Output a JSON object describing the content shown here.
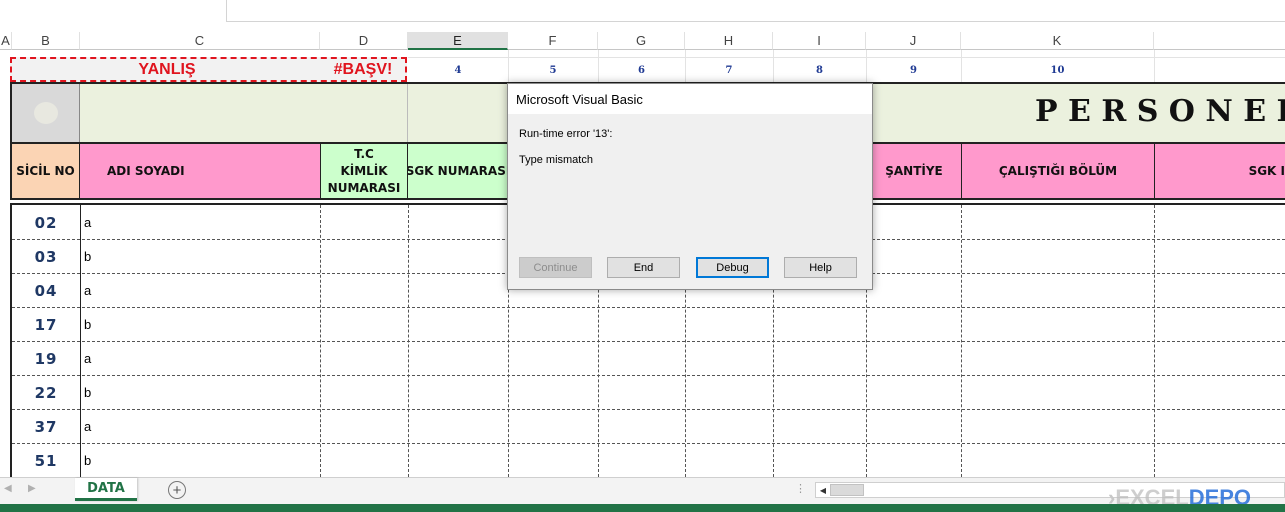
{
  "columns": [
    "A",
    "B",
    "C",
    "D",
    "E",
    "F",
    "G",
    "H",
    "I",
    "J",
    "K"
  ],
  "top_row": {
    "error_label": "YANLIŞ",
    "error_value": "#BAŞV!",
    "indices": [
      "4",
      "5",
      "6",
      "7",
      "8",
      "9",
      "10"
    ]
  },
  "title": "P E R S O N E L İ",
  "headers": {
    "sicil_no": "SİCİL NO",
    "adi_soyadi": "ADI SOYADI",
    "tc_line1": "T.C",
    "tc_line2": "KİMLİK",
    "tc_line3": "NUMARASI",
    "sgk_numarasi": "SGK NUMARASI",
    "santiye": "ŞANTİYE",
    "calistigi_bolum": "ÇALIŞTIĞI BÖLÜM",
    "sgk_partial": "SGK I"
  },
  "rows": [
    {
      "sicil": "02",
      "name": "a"
    },
    {
      "sicil": "03",
      "name": "b"
    },
    {
      "sicil": "04",
      "name": "a"
    },
    {
      "sicil": "17",
      "name": "b"
    },
    {
      "sicil": "19",
      "name": "a"
    },
    {
      "sicil": "22",
      "name": "b"
    },
    {
      "sicil": "37",
      "name": "a"
    },
    {
      "sicil": "51",
      "name": "b"
    }
  ],
  "dialog": {
    "title": "Microsoft Visual Basic",
    "error_line": "Run-time error '13':",
    "message": "Type mismatch",
    "buttons": {
      "continue": "Continue",
      "end": "End",
      "debug": "Debug",
      "help": "Help"
    }
  },
  "sheet_tabs": {
    "active": "DATA",
    "add_icon": "plus-circle-icon"
  },
  "watermark": {
    "part1": "EXCEL",
    "part2": "DEPO"
  },
  "colors": {
    "orange_header": "#fbd4b4",
    "pink_header": "#ff99cc",
    "green_header": "#ccffcc",
    "title_bg": "#ebf1de",
    "error_red": "#e0141e",
    "excel_green": "#217346"
  }
}
